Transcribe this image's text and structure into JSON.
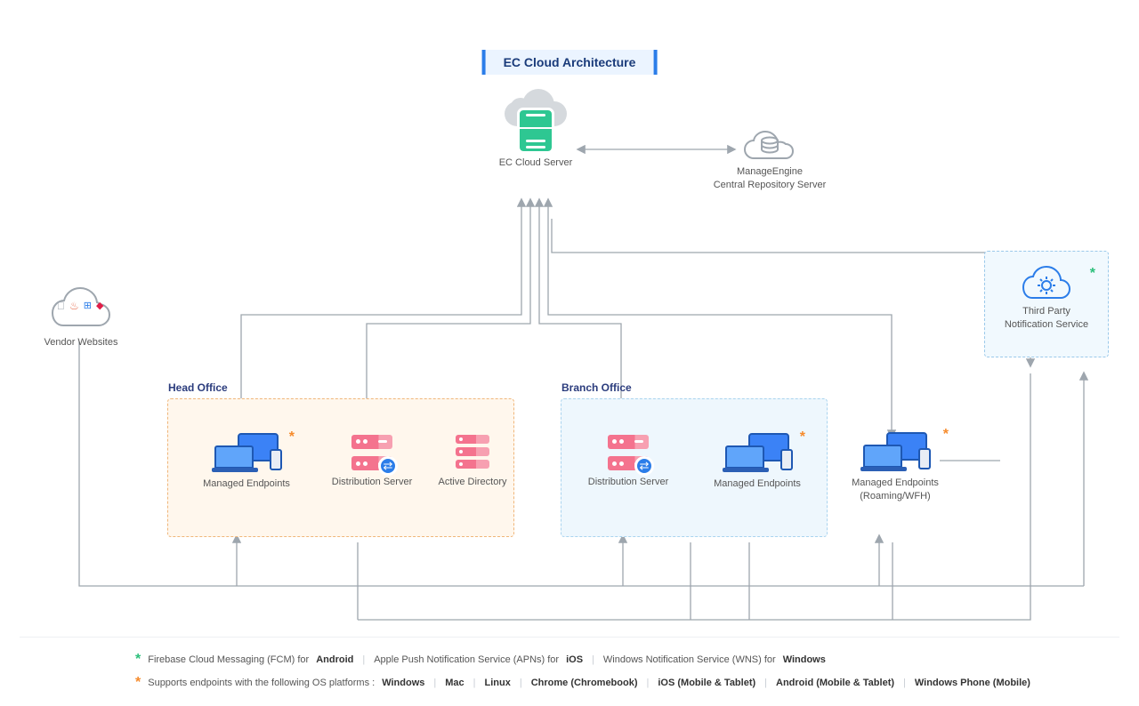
{
  "title": "EC Cloud Architecture",
  "nodes": {
    "cloud_server": "EC Cloud Server",
    "central_repo_line1": "ManageEngine",
    "central_repo_line2": "Central Repository Server",
    "vendor": "Vendor Websites",
    "tpn_line1": "Third Party",
    "tpn_line2": "Notification Service",
    "head_office": "Head Office",
    "branch_office": "Branch Office",
    "managed_ep": "Managed Endpoints",
    "dist_server": "Distribution Server",
    "active_dir": "Active Directory",
    "roam_line1": "Managed Endpoints",
    "roam_line2": "(Roaming/WFH)"
  },
  "footer": {
    "l1_fcm": "Firebase Cloud Messaging (FCM) for",
    "l1_android": "Android",
    "l1_apns": "Apple Push Notification Service (APNs) for",
    "l1_ios": "iOS",
    "l1_wns": "Windows Notification Service (WNS) for",
    "l1_win": "Windows",
    "l2_pref": "Supports endpoints with the following OS platforms :",
    "l2_win": "Windows",
    "l2_mac": "Mac",
    "l2_linux": "Linux",
    "l2_chrome": "Chrome (Chromebook)",
    "l2_ios": "iOS (Mobile & Tablet)",
    "l2_android": "Android (Mobile & Tablet)",
    "l2_wp": "Windows Phone (Mobile)"
  },
  "colors": {
    "accent": "#2b7de9",
    "zone_head_bg": "#fff7ed",
    "zone_head_border": "#f0b67a",
    "zone_branch_bg": "#eef7fd",
    "zone_branch_border": "#aad4ef",
    "connector": "#9ea6ae",
    "pink": "#f4738e",
    "green": "#2ec792"
  }
}
